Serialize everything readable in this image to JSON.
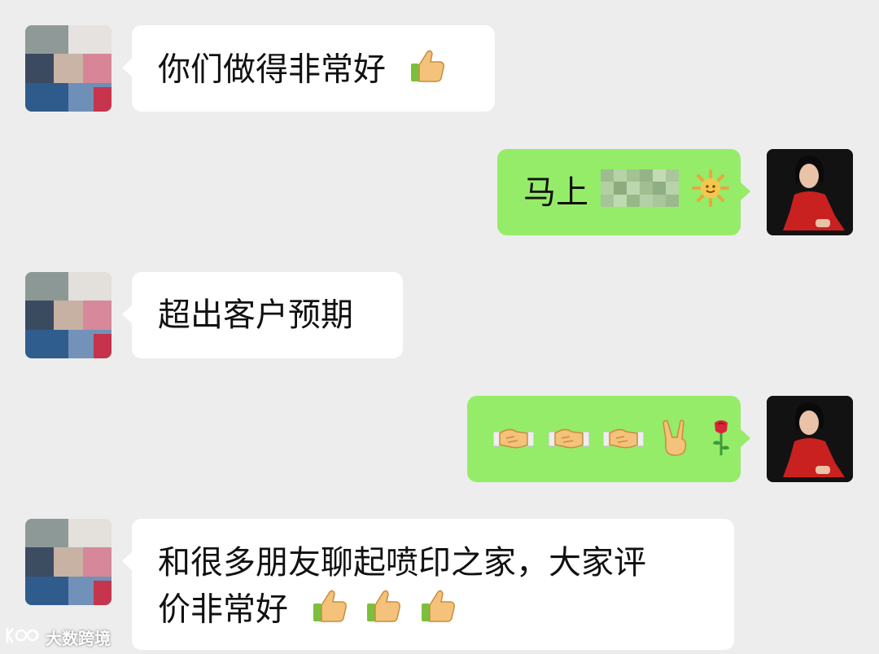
{
  "messages": [
    {
      "side": "left",
      "text": "你们做得非常好",
      "emoji": [
        "thumbs-up"
      ]
    },
    {
      "side": "right",
      "text": "马上",
      "redacted": true,
      "emoji": [
        "sun"
      ]
    },
    {
      "side": "left",
      "text": "超出客户预期",
      "emoji": []
    },
    {
      "side": "right",
      "text": "",
      "emoji": [
        "handshake",
        "handshake",
        "handshake",
        "victory-hand",
        "rose"
      ]
    },
    {
      "side": "left",
      "text_line1": "和很多朋友聊起喷印之家，大家评",
      "text_line2": "价非常好",
      "emoji": [
        "thumbs-up",
        "thumbs-up",
        "thumbs-up"
      ]
    }
  ],
  "watermark": {
    "text": "大数跨境"
  },
  "colors": {
    "background": "#ededed",
    "incoming_bubble": "#ffffff",
    "outgoing_bubble": "#95ec69",
    "text": "#111111"
  }
}
